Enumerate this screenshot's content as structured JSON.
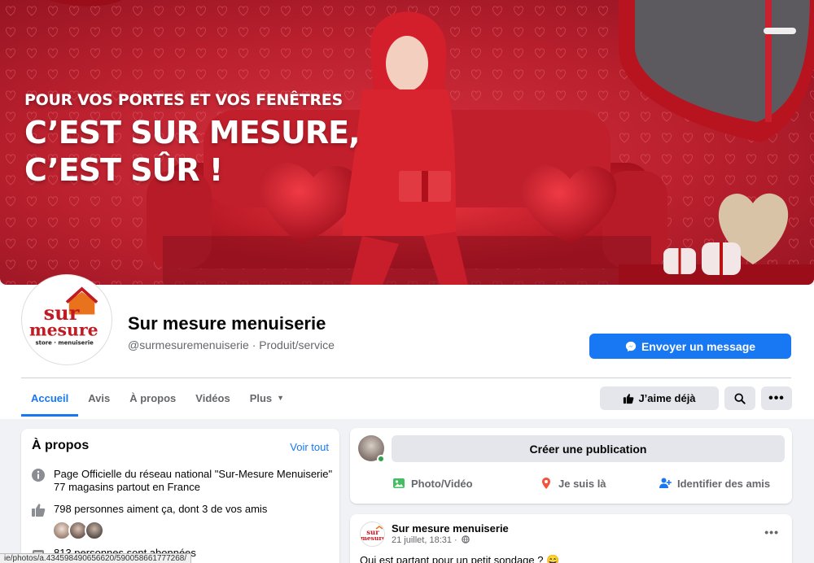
{
  "cover": {
    "headline_1": "POUR VOS PORTES ET VOS FENÊTRES",
    "headline_2": "C’EST SUR MESURE,",
    "headline_3": "C’EST SÛR !",
    "brand_color": "#c81f2f"
  },
  "profile": {
    "logo_text_top": "sur",
    "logo_text_bottom": "mesure",
    "logo_tagline": "store · menuiserie",
    "name": "Sur mesure menuiserie",
    "handle": "@surmesuremenuiserie · Produit/service",
    "message_button": "Envoyer un message",
    "message_icon": "messenger-icon"
  },
  "tabs": [
    {
      "label": "Accueil",
      "active": true
    },
    {
      "label": "Avis",
      "active": false
    },
    {
      "label": "À propos",
      "active": false
    },
    {
      "label": "Vidéos",
      "active": false
    },
    {
      "label": "Plus",
      "active": false
    }
  ],
  "actions": {
    "like_label": "J’aime déjà",
    "like_icon": "thumbs-up-icon",
    "search_icon": "search-icon",
    "more_icon": "more-dots-icon"
  },
  "about": {
    "title": "À propos",
    "see_all": "Voir tout",
    "description_1": "Page Officielle du réseau national \"Sur-Mesure Menuiserie\"",
    "description_2": "77 magasins partout en France",
    "likes": "798 personnes aiment ça, dont 3 de vos amis",
    "followers": "813 personnes sont abonnées"
  },
  "composer": {
    "placeholder": "Créer une publication",
    "photo_label": "Photo/Vidéo",
    "checkin_label": "Je suis là",
    "tag_label": "Identifier des amis",
    "accent": "#1877f2"
  },
  "post": {
    "author": "Sur mesure menuiserie",
    "date": "21 juillet, 18:31 ·",
    "text": "Qui est partant pour un petit sondage ? 😄"
  },
  "status_bar": {
    "url": "ie/photos/a.434598490656620/590058661777268/"
  }
}
